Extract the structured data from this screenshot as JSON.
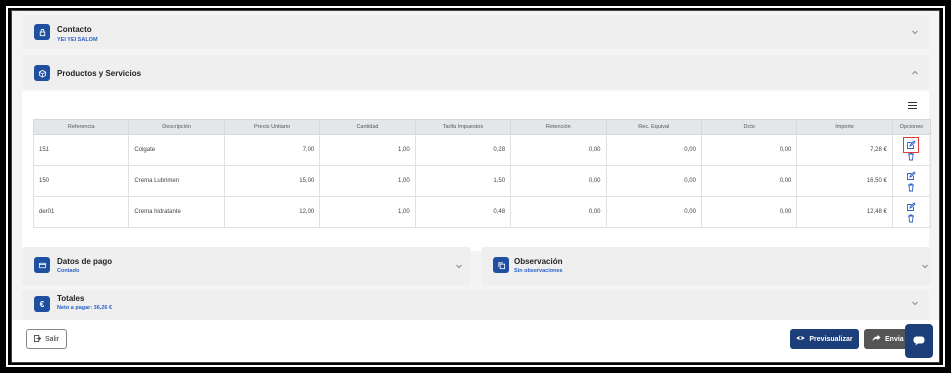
{
  "contacto": {
    "title": "Contacto",
    "subtitle": "YEI YEI SALOM"
  },
  "productos": {
    "title": "Productos y Servicios",
    "columns": [
      "Referencia",
      "Descripción",
      "Precio Unitario",
      "Cantidad",
      "Tarifa Impuestos",
      "Retención",
      "Rec. Equival",
      "Dcto",
      "Importe",
      "Opciones"
    ],
    "rows": [
      {
        "ref": "151",
        "desc": "Colgate",
        "precio": "7,00",
        "cantidad": "1,00",
        "tarifa": "0,28",
        "retencion": "0,00",
        "rec": "0,00",
        "dcto": "0,00",
        "importe": "7,28 €"
      },
      {
        "ref": "150",
        "desc": "Crema Lubrimen",
        "precio": "15,00",
        "cantidad": "1,00",
        "tarifa": "1,50",
        "retencion": "0,00",
        "rec": "0,00",
        "dcto": "0,00",
        "importe": "16,50 €"
      },
      {
        "ref": "der01",
        "desc": "Crema hidratante",
        "precio": "12,00",
        "cantidad": "1,00",
        "tarifa": "0,48",
        "retencion": "0,00",
        "rec": "0,00",
        "dcto": "0,00",
        "importe": "12,48 €"
      }
    ]
  },
  "pago": {
    "title": "Datos de pago",
    "subtitle": "Contado"
  },
  "observacion": {
    "title": "Observación",
    "subtitle": "Sin observaciones"
  },
  "totales": {
    "title": "Totales",
    "subtitle": "Neto a pagar: 36,26 €"
  },
  "footer": {
    "salir": "Salir",
    "previsualizar": "Previsualizar",
    "enviar": "Envia"
  },
  "colors": {
    "accent": "#1f4fa0",
    "link": "#2a62c9",
    "highlight": "#e53935"
  },
  "icons": [
    "lock-icon",
    "box-icon",
    "card-icon",
    "copy-icon",
    "euro-icon",
    "menu-icon",
    "edit-icon",
    "trash-icon",
    "exit-icon",
    "eye-icon",
    "share-icon",
    "chat-icon",
    "chevron-down-icon",
    "chevron-up-icon"
  ]
}
